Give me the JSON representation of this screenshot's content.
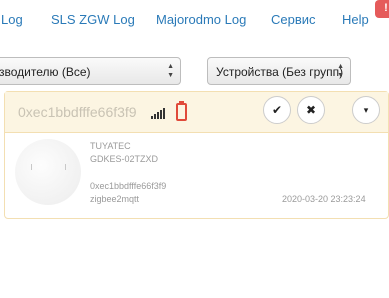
{
  "nav": {
    "items": [
      "Log",
      "SLS ZGW Log",
      "Majorodmo Log",
      "Сервис",
      "Help"
    ],
    "badge": "!"
  },
  "filters": {
    "vendor": "зводителю (Все)",
    "group": "Устройства (Без групп)"
  },
  "device": {
    "id": "0xec1bbdfffe66f3f9",
    "vendor": "TUYATEC",
    "model": "GDKES-02TZXD",
    "ieee": "0xec1bbdfffe66f3f9",
    "source": "zigbee2mqtt",
    "last_seen": "2020-03-20 23:23:24",
    "icons": {
      "signal": "signal-icon",
      "battery": "battery-icon",
      "ok": "check-icon",
      "delete": "close-icon",
      "menu": "caret-down-icon"
    },
    "colors": {
      "battery": "#e04a3a",
      "header_bg": "#fcf5e2",
      "link": "#2a7ab8"
    }
  },
  "buttons": {
    "ok": "✔",
    "delete": "✖",
    "menu": "▾"
  },
  "arrows": "▲▼"
}
